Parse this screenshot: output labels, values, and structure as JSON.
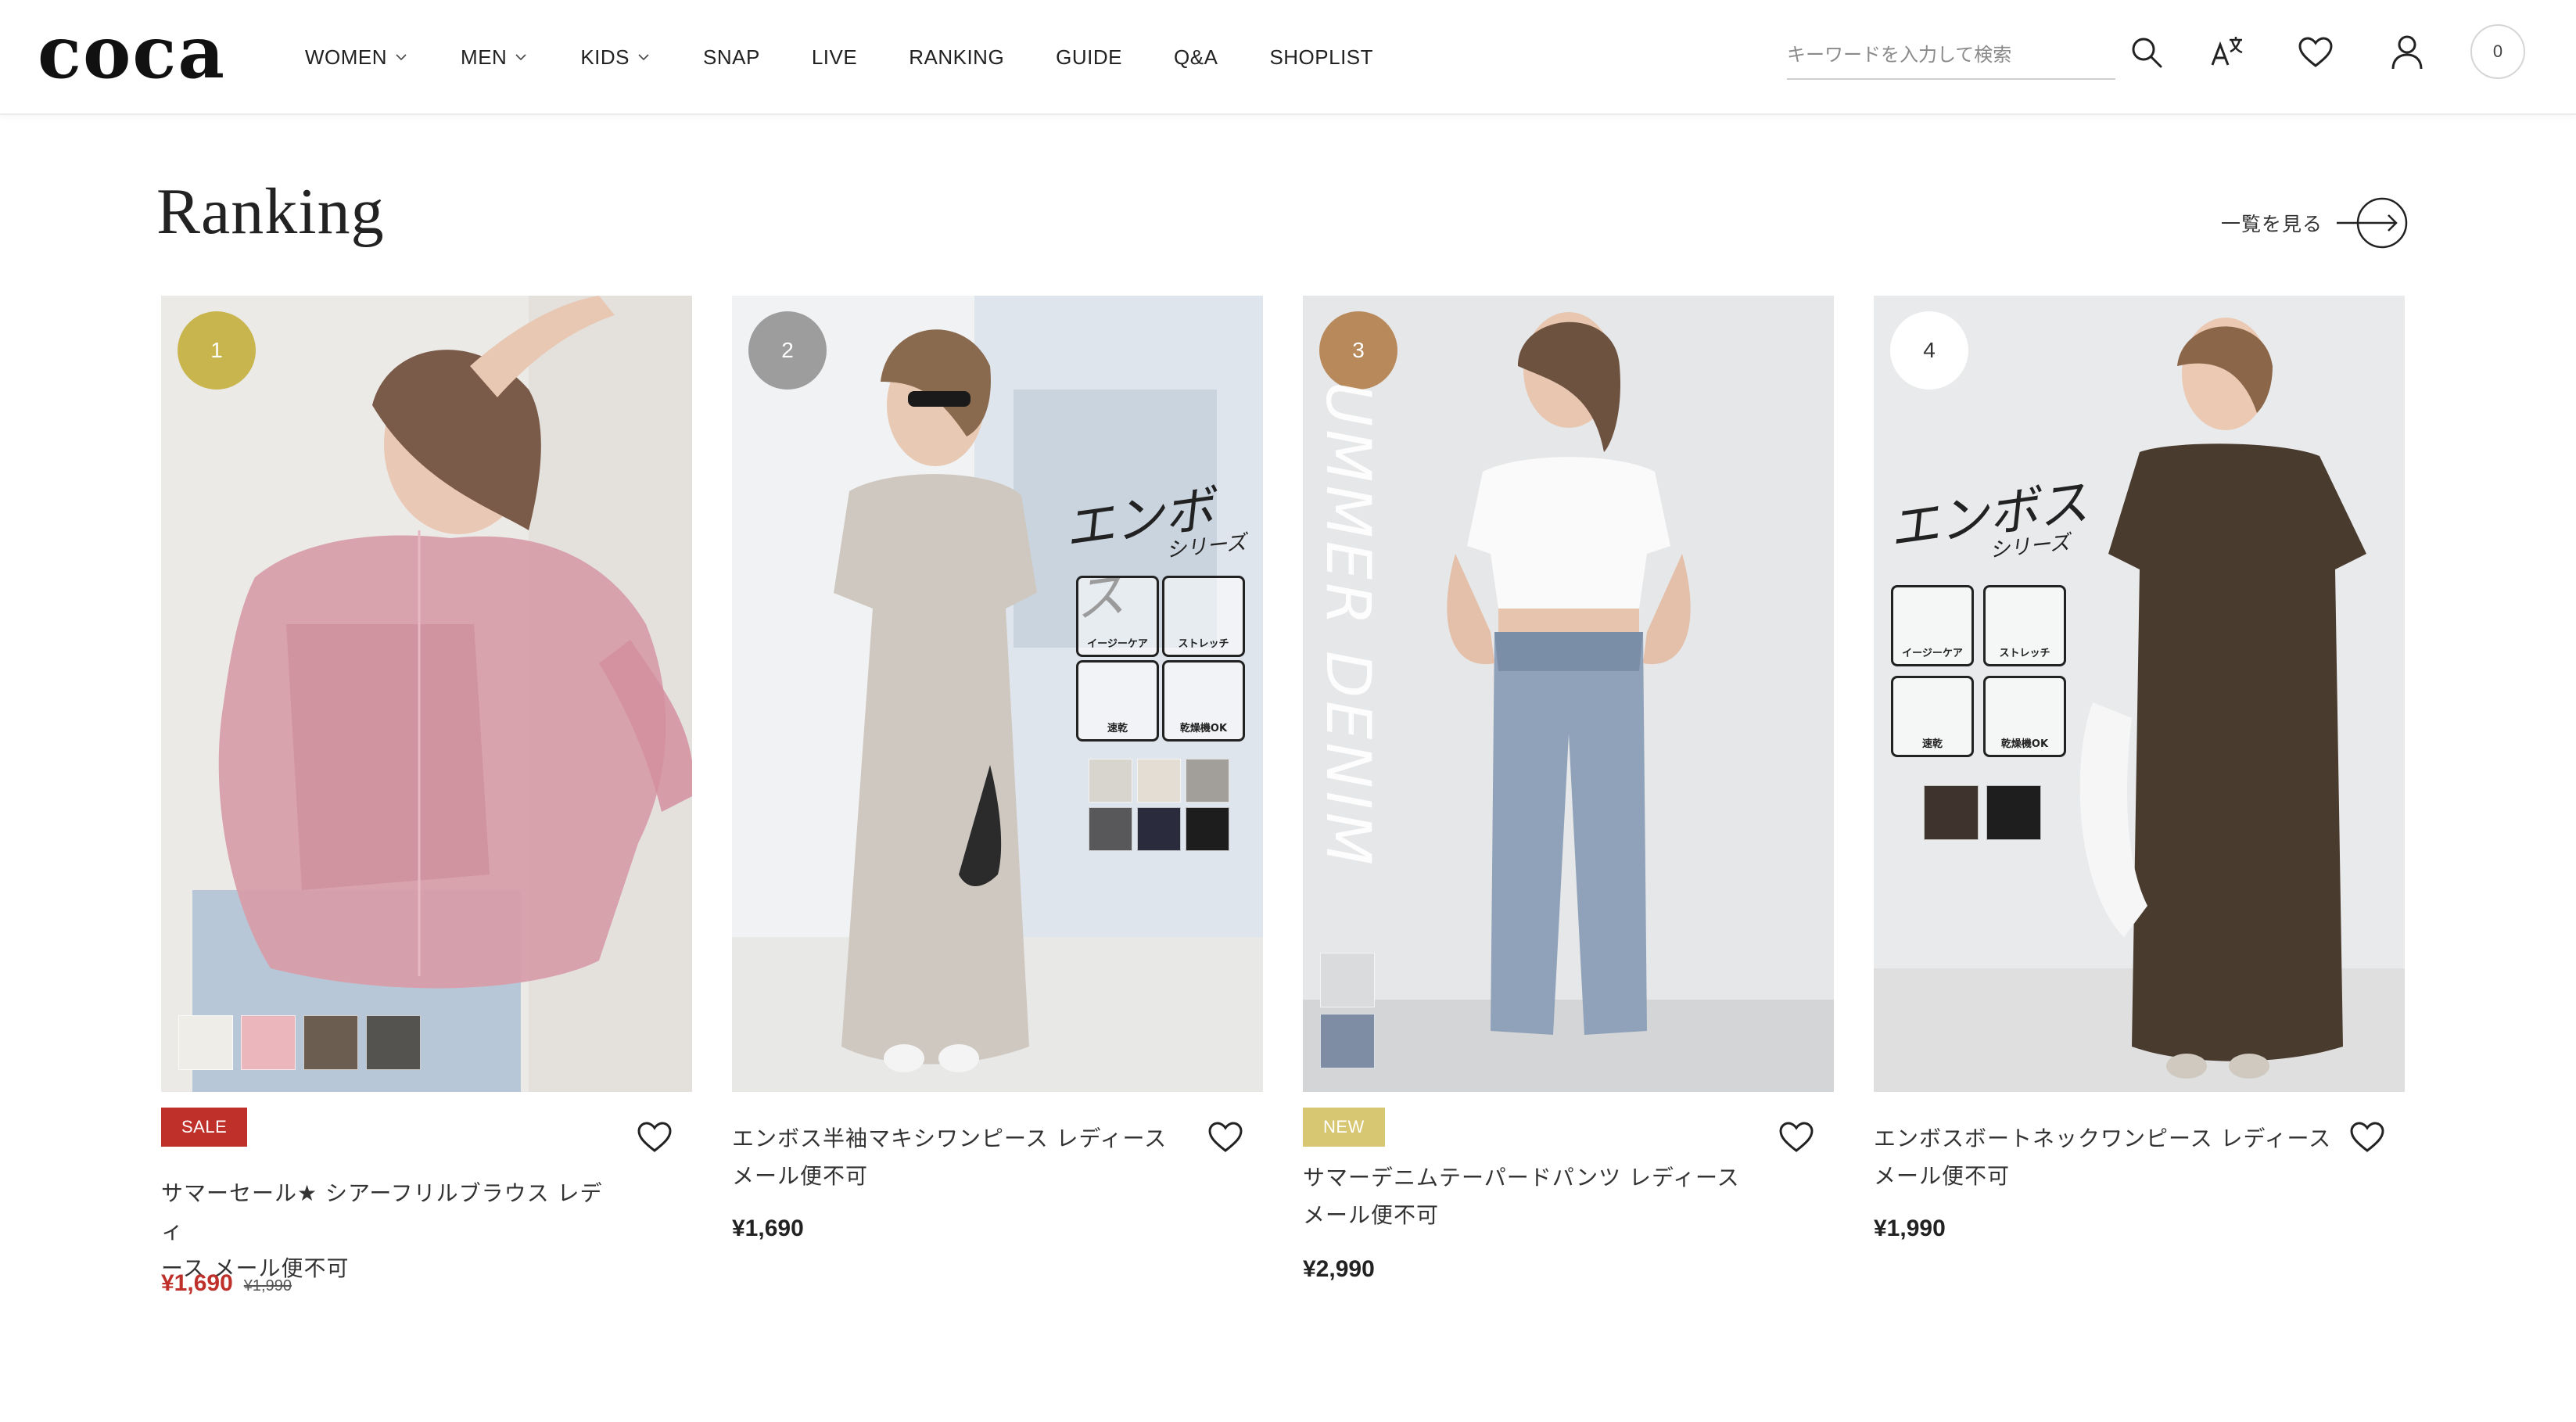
{
  "header": {
    "logo": "coca",
    "nav": [
      {
        "label": "WOMEN",
        "dropdown": true
      },
      {
        "label": "MEN",
        "dropdown": true
      },
      {
        "label": "KIDS",
        "dropdown": true
      },
      {
        "label": "SNAP",
        "dropdown": false
      },
      {
        "label": "LIVE",
        "dropdown": false
      },
      {
        "label": "RANKING",
        "dropdown": false
      },
      {
        "label": "GUIDE",
        "dropdown": false
      },
      {
        "label": "Q&A",
        "dropdown": false
      },
      {
        "label": "SHOPLIST",
        "dropdown": false
      }
    ],
    "search_placeholder": "キーワードを入力して検索",
    "cart_count": "0",
    "icons": [
      "search-icon",
      "translate-icon",
      "heart-icon",
      "user-icon",
      "cart-icon"
    ]
  },
  "section": {
    "title": "Ranking",
    "view_all": "一覧を見る"
  },
  "products": [
    {
      "rank": "1",
      "rank_color": "#c9b54d",
      "tag": "SALE",
      "tag_color": "#c0302a",
      "name_line1": "サマーセール★ シアーフリルブラウス レディ",
      "name_line2": "ース メール便不可",
      "price": "¥1,690",
      "original_price": "¥1,990",
      "swatches": [
        "#efede8",
        "#ecb6bd",
        "#6b5d4f",
        "#545350"
      ]
    },
    {
      "rank": "2",
      "rank_color": "#9d9d9d",
      "tag": "",
      "name_line1": "エンボス半袖マキシワンピース レディース",
      "name_line2": "メール便不可",
      "price": "¥1,690",
      "series_title": "エンボス",
      "series_sub": "シリーズ",
      "features": [
        "イージーケア",
        "ストレッチ",
        "速乾",
        "乾燥機OK"
      ],
      "swatches": [
        "#d8d5cf",
        "#e3ddd4",
        "#a29e99",
        "#58585a",
        "#2a2c3d",
        "#1d1d1d"
      ]
    },
    {
      "rank": "3",
      "rank_color": "#b8895a",
      "tag": "NEW",
      "tag_color": "#d8c772",
      "name_line1": "サマーデニムテーパードパンツ レディース",
      "name_line2": "メール便不可",
      "price": "¥2,990",
      "overlay_text": "UMMER DENIM",
      "swatches": [
        "#d9dbdc",
        "#7f8da4"
      ]
    },
    {
      "rank": "4",
      "rank_color": "#ffffff",
      "tag": "",
      "name_line1": "エンボスボートネックワンピース レディース",
      "name_line2": "メール便不可",
      "price": "¥1,990",
      "series_title": "エンボス",
      "series_sub": "シリーズ",
      "features": [
        "イージーケア",
        "ストレッチ",
        "速乾",
        "乾燥機OK"
      ],
      "swatches": [
        "#3f342d",
        "#1e1e1e"
      ]
    }
  ]
}
